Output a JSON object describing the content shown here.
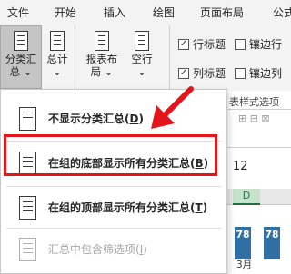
{
  "tabs": [
    "文件",
    "开始",
    "插入",
    "绘图",
    "页面布局",
    "公式"
  ],
  "ribbon": {
    "subtotal_label_1": "分类汇",
    "subtotal_label_2": "总",
    "total_label_1": "总计",
    "report_layout_1": "报表布",
    "report_layout_2": "局",
    "blank_rows_1": "空行",
    "row_headers": "行标题",
    "col_headers": "列标题",
    "banded_rows": "镶边行",
    "banded_cols": "镶边列",
    "group_label": "表样式选项"
  },
  "sheet": {
    "number_cell": "12",
    "col_header": "D",
    "cell_values": [
      "78",
      "78"
    ],
    "month_label": "3月"
  },
  "menu": {
    "items": [
      {
        "label": "不显示分类汇总(",
        "key": "D",
        "tail": ")"
      },
      {
        "label": "在组的底部显示所有分类汇总(",
        "key": "B",
        "tail": ")"
      },
      {
        "label": "在组的顶部显示所有分类汇总(",
        "key": "T",
        "tail": ")"
      },
      {
        "label": "汇总中包含筛选项(",
        "key": "I",
        "tail": ")"
      }
    ]
  }
}
